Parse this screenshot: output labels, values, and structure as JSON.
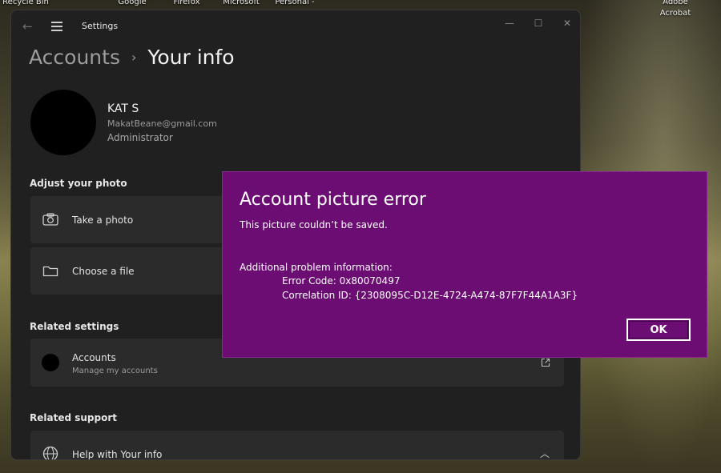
{
  "desktop": {
    "icons": [
      "Recycle Bin",
      "Google",
      "Firefox",
      "Microsoft",
      "Personal -",
      "Adobe",
      "Acrobat"
    ]
  },
  "window": {
    "title": "Settings",
    "minimize": "—",
    "maximize": "☐",
    "close": "✕"
  },
  "breadcrumb": {
    "parent": "Accounts",
    "separator": "›",
    "current": "Your info"
  },
  "user": {
    "name": "KAT S",
    "email": "MakatBeane@gmail.com",
    "role": "Administrator"
  },
  "adjust_photo": {
    "heading": "Adjust your photo",
    "take_photo": "Take a photo",
    "choose_file": "Choose a file"
  },
  "related_settings": {
    "heading": "Related settings",
    "accounts_title": "Accounts",
    "accounts_subtitle": "Manage my accounts"
  },
  "related_support": {
    "heading": "Related support",
    "help_item": "Help with Your info"
  },
  "dialog": {
    "title": "Account picture error",
    "message": "This picture couldn’t be saved.",
    "info_heading": "Additional problem information:",
    "error_code": "Error Code: 0x80070497",
    "correlation_id": "Correlation ID: {2308095C-D12E-4724-A474-87F7F44A1A3F}",
    "ok_label": "OK"
  },
  "colors": {
    "dialog_bg": "#6b0d73",
    "window_bg": "#202020",
    "card_bg": "#2b2b2b"
  }
}
